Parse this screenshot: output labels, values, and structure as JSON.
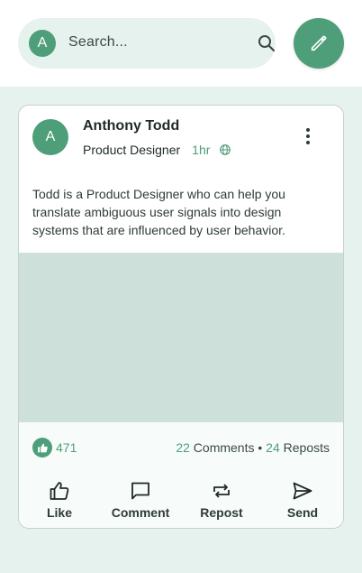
{
  "topbar": {
    "avatar_initial": "A",
    "search_placeholder": "Search...",
    "search_icon": "search-icon",
    "compose_icon": "pencil-icon"
  },
  "post": {
    "avatar_initial": "A",
    "author": "Anthony Todd",
    "role": "Product Designer",
    "time": "1hr",
    "visibility_icon": "globe-icon",
    "menu_icon": "more-vertical-icon",
    "text": "Todd is a Product Designer who can help you translate ambiguous user signals into design systems that are influenced by user behavior.",
    "likes": "471",
    "comments_count": "22",
    "comments_label": "Comments",
    "separator": "•",
    "reposts_count": "24",
    "reposts_label": "Reposts"
  },
  "actions": [
    {
      "label": "Like",
      "icon": "thumb-up-icon"
    },
    {
      "label": "Comment",
      "icon": "comment-icon"
    },
    {
      "label": "Repost",
      "icon": "repost-icon"
    },
    {
      "label": "Send",
      "icon": "send-icon"
    }
  ],
  "colors": {
    "accent": "#4f9e7a",
    "background": "#e6f2ee",
    "media_placeholder": "#cde1da"
  }
}
